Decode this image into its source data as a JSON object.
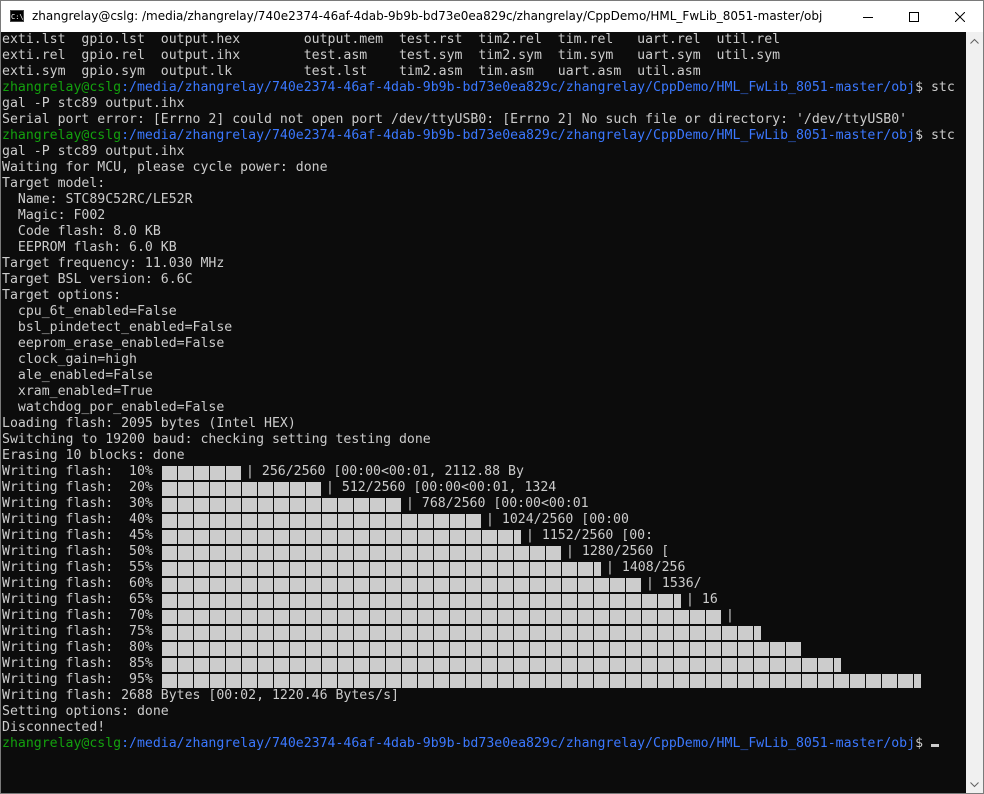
{
  "window": {
    "title": "zhangrelay@cslg: /media/zhangrelay/740e2374-46af-4dab-9b9b-bd73e0ea829c/zhangrelay/CppDemo/HML_FwLib_8051-master/obj",
    "icon_label": "C:\\",
    "controls": [
      "minimize-icon",
      "maximize-icon",
      "close-icon"
    ]
  },
  "colors": {
    "background": "#0c0c0c",
    "text": "#cccccc",
    "prompt_user": "#13a10e",
    "prompt_path": "#3b78ff"
  },
  "prompt": {
    "user": "zhangrelay@cslg",
    "path": ":/media/zhangrelay/740e2374-46af-4dab-9b9b-bd73e0ea829c/zhangrelay/CppDemo/HML_FwLib_8051-master/obj",
    "dollar": "$ "
  },
  "files": [
    "exti.lst  gpio.lst  output.hex        output.mem  test.rst  tim2.rel  tim.rel   uart.rel  util.rel",
    "exti.rel  gpio.rel  output.ihx        test.asm    test.sym  tim2.sym  tim.sym   uart.sym  util.sym",
    "exti.sym  gpio.sym  output.lk         test.lst    tim2.asm  tim.asm   uart.asm  util.asm"
  ],
  "cmd1_part1": "stc",
  "cmd1_part2": "gal -P stc89 output.ihx",
  "error_line": "Serial port error: [Errno 2] could not open port /dev/ttyUSB0: [Errno 2] No such file or directory: '/dev/ttyUSB0'",
  "cmd2_part1": "stc",
  "cmd2_part2": "gal -P stc89 output.ihx",
  "output_lines": [
    "Waiting for MCU, please cycle power: done",
    "Target model:",
    "  Name: STC89C52RC/LE52R",
    "  Magic: F002",
    "  Code flash: 8.0 KB",
    "  EEPROM flash: 6.0 KB",
    "Target frequency: 11.030 MHz",
    "Target BSL version: 6.6C",
    "Target options:",
    "  cpu_6t_enabled=False",
    "  bsl_pindetect_enabled=False",
    "  eeprom_erase_enabled=False",
    "  clock_gain=high",
    "  ale_enabled=False",
    "  xram_enabled=True",
    "  watchdog_por_enabled=False",
    "Loading flash: 2095 bytes (Intel HEX)",
    "Switching to 19200 baud: checking setting testing done",
    "Erasing 10 blocks: done"
  ],
  "progress": [
    {
      "label": "Writing flash:  10%",
      "fraction": 0.1,
      "tail": "| 256/2560 [00:00<00:01, 2112.88 By"
    },
    {
      "label": "Writing flash:  20%",
      "fraction": 0.2,
      "tail": "| 512/2560 [00:00<00:01, 1324"
    },
    {
      "label": "Writing flash:  30%",
      "fraction": 0.3,
      "tail": "| 768/2560 [00:00<00:01"
    },
    {
      "label": "Writing flash:  40%",
      "fraction": 0.4,
      "tail": "| 1024/2560 [00:00"
    },
    {
      "label": "Writing flash:  45%",
      "fraction": 0.45,
      "tail": "| 1152/2560 [00:"
    },
    {
      "label": "Writing flash:  50%",
      "fraction": 0.5,
      "tail": "| 1280/2560 ["
    },
    {
      "label": "Writing flash:  55%",
      "fraction": 0.55,
      "tail": "| 1408/256"
    },
    {
      "label": "Writing flash:  60%",
      "fraction": 0.6,
      "tail": "| 1536/"
    },
    {
      "label": "Writing flash:  65%",
      "fraction": 0.65,
      "tail": "| 16"
    },
    {
      "label": "Writing flash:  70%",
      "fraction": 0.7,
      "tail": "|"
    },
    {
      "label": "Writing flash:  75%",
      "fraction": 0.75,
      "tail": ""
    },
    {
      "label": "Writing flash:  80%",
      "fraction": 0.8,
      "tail": ""
    },
    {
      "label": "Writing flash:  85%",
      "fraction": 0.85,
      "tail": ""
    },
    {
      "label": "Writing flash:  95%",
      "fraction": 0.95,
      "tail": ""
    }
  ],
  "after_lines": [
    "Writing flash: 2688 Bytes [00:02, 1220.46 Bytes/s]",
    "Setting options: done",
    "Disconnected!"
  ]
}
